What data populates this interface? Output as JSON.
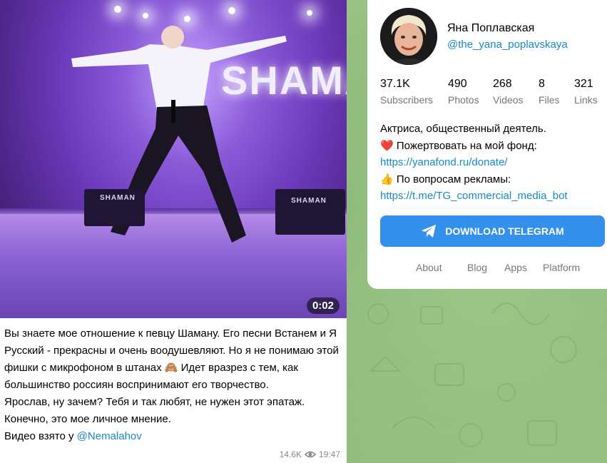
{
  "post": {
    "video_duration": "0:02",
    "video_overlay_text": "SHAMAN",
    "speaker_labels": [
      "SHAMAN",
      "SHAMAN"
    ],
    "lines": [
      "Вы знаете мое отношение к певцу Шаману. Его песни Встанем и Я Русский - прекрасны и очень воодушевляют. Но я не понимаю этой фишки с микрофоном в штанах 🙈 Идет вразрез с тем, как большинство россиян воспринимают его творчество.",
      "Ярослав, ну зачем? Тебя и так любят, не нужен этот эпатаж.",
      "Конечно, это мое личное мнение."
    ],
    "source_prefix": "Видео взято у ",
    "source_link": "@Nemalahov",
    "views": "14.6K",
    "time": "19:47"
  },
  "profile": {
    "name": "Яна Поплавская",
    "handle": "@the_yana_poplavskaya",
    "stats": [
      {
        "value": "37.1K",
        "label": "Subscribers"
      },
      {
        "value": "490",
        "label": "Photos"
      },
      {
        "value": "268",
        "label": "Videos"
      },
      {
        "value": "8",
        "label": "Files"
      },
      {
        "value": "321",
        "label": "Links"
      }
    ],
    "description_line1": "Актриса, общественный деятель.",
    "donate_emoji": "❤️",
    "donate_text": "Пожертвовать на мой фонд:",
    "donate_link": "https://yanafond.ru/donate/",
    "ads_emoji": "👍",
    "ads_text": "По вопросам рекламы:",
    "ads_link": "https://t.me/TG_commercial_media_bot",
    "download_button": "DOWNLOAD TELEGRAM",
    "footer_links": [
      "About",
      "Blog",
      "Apps",
      "Platform"
    ]
  },
  "colors": {
    "link": "#168acd",
    "button": "#3390ec",
    "background": "#8fbf7e"
  }
}
